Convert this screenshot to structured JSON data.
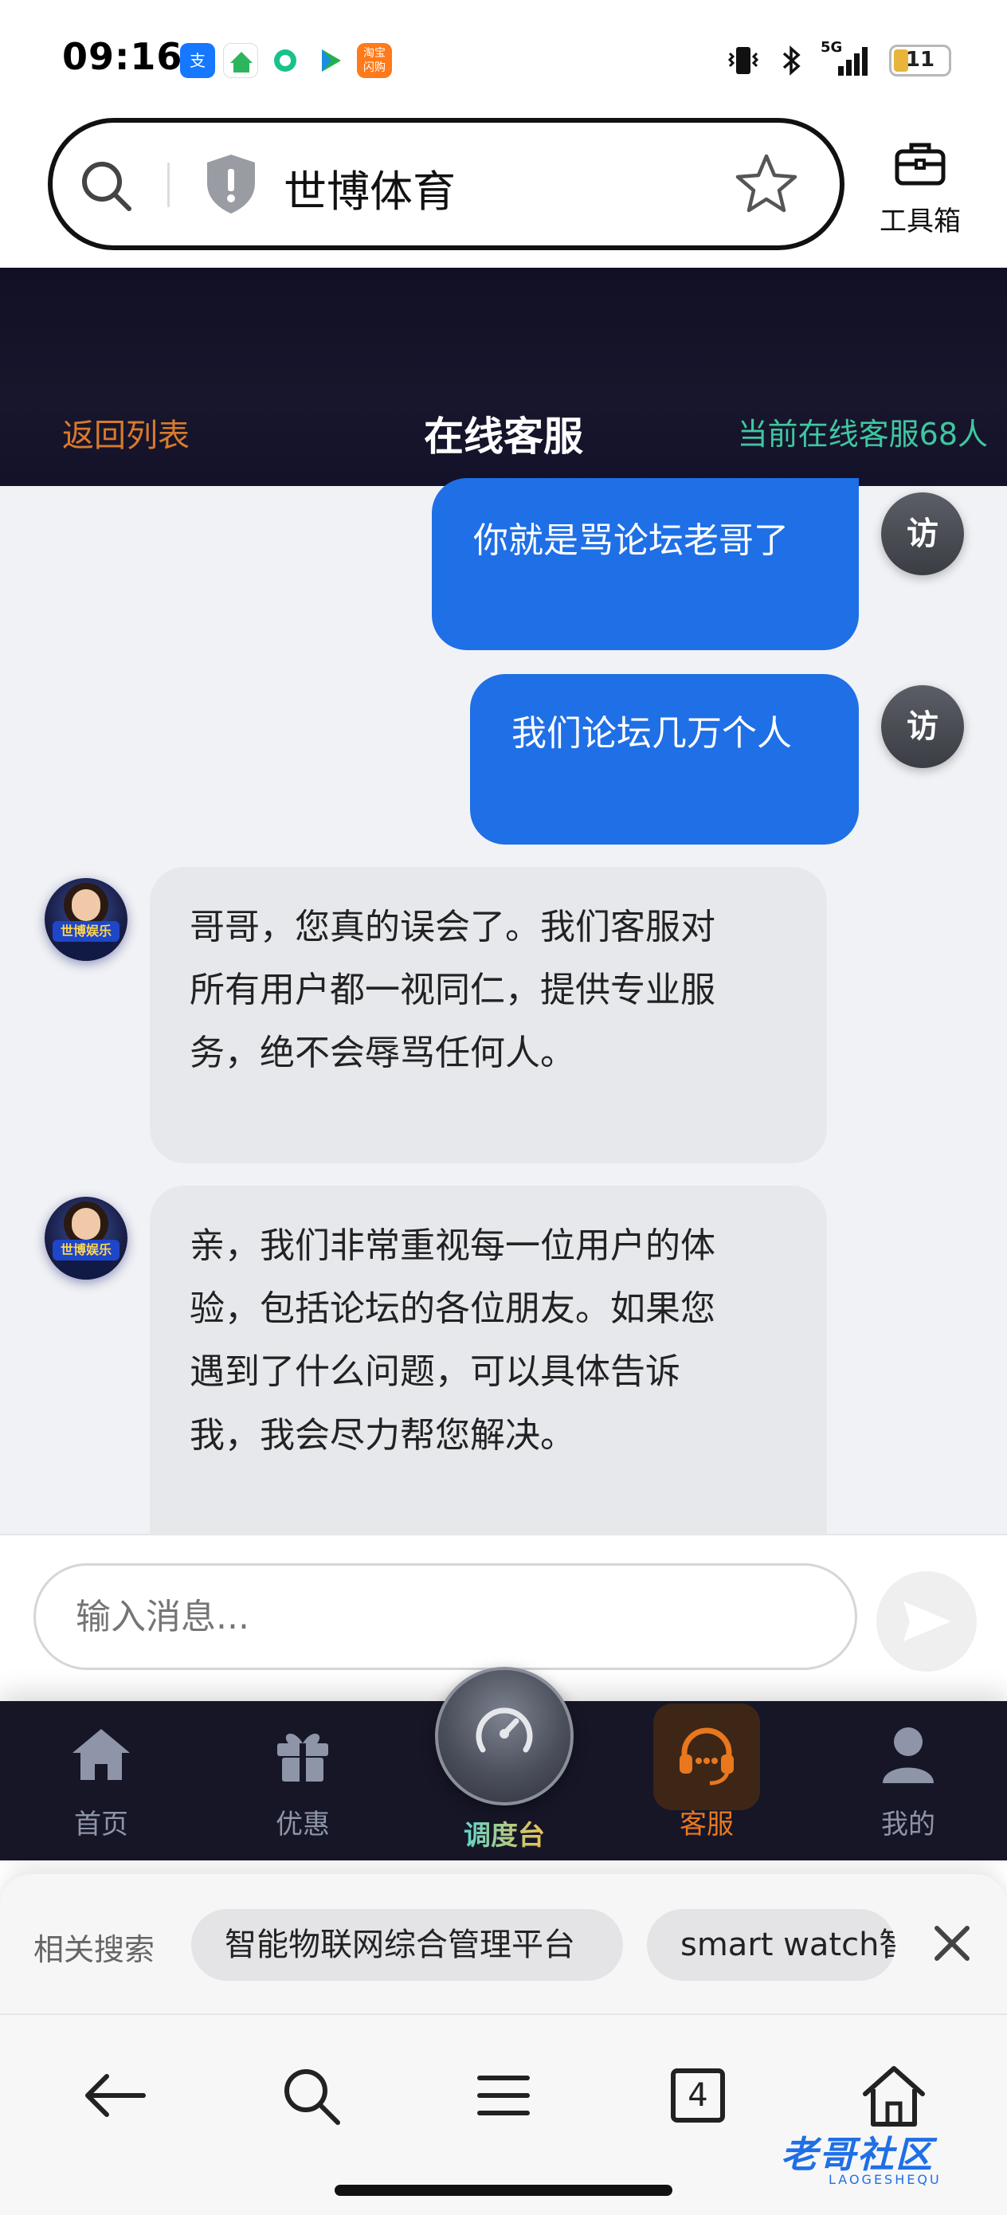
{
  "status_bar": {
    "time": "09:16",
    "apps": [
      "alipay-icon",
      "anjuke-icon",
      "app-icon",
      "video-app-icon",
      "taobao-icon"
    ],
    "network": "5G",
    "battery": "11"
  },
  "browser": {
    "url_text": "世博体育",
    "toolbox_label": "工具箱"
  },
  "header": {
    "back": "返回列表",
    "title": "在线客服",
    "online": "当前在线客服68人"
  },
  "messages": [
    {
      "from": "visitor",
      "avatar": "访",
      "text": "你就是骂论坛老哥了"
    },
    {
      "from": "visitor",
      "avatar": "访",
      "text": "我们论坛几万个人"
    },
    {
      "from": "agent",
      "lines": [
        "哥哥，您真的误会了。我们客服对",
        "所有用户都一视同仁，提供专业服",
        "务，绝不会辱骂任何人。"
      ]
    },
    {
      "from": "agent",
      "lines": [
        "亲，我们非常重视每一位用户的体",
        "验，包括论坛的各位朋友。如果您",
        "遇到了什么问题，可以具体告诉",
        "我，我会尽力帮您解决。"
      ]
    }
  ],
  "agent_avatar_badge": "世博娱乐",
  "input": {
    "placeholder": "输入消息..."
  },
  "bottom_nav": [
    {
      "label": "首页",
      "icon": "home-icon",
      "color": "#8e95a8"
    },
    {
      "label": "优惠",
      "icon": "gift-icon",
      "color": "#8e95a8"
    },
    {
      "label": "调度台",
      "icon": "dashboard-icon",
      "color": "#f2c14e"
    },
    {
      "label": "客服",
      "icon": "headset-icon",
      "color": "#e8771e"
    },
    {
      "label": "我的",
      "icon": "user-icon",
      "color": "#8e95a8"
    }
  ],
  "related": {
    "label": "相关搜索",
    "chips": [
      "智能物联网综合管理平台",
      "smart watch智"
    ]
  },
  "browser_toolbar": {
    "tabs_count": "4"
  },
  "watermark": {
    "text": "老哥社区",
    "sub": "LAOGESHEQU"
  }
}
